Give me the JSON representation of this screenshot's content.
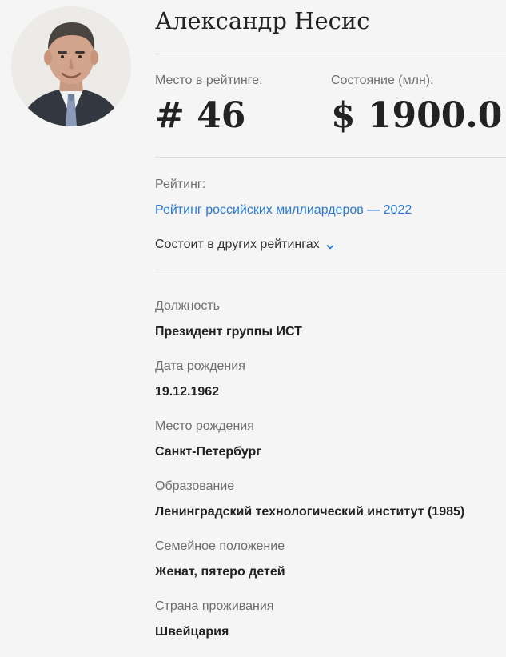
{
  "profile": {
    "name": "Александр Несис"
  },
  "stats": {
    "rank_label": "Место в рейтинге:",
    "rank_value": "# 46",
    "worth_label": "Состояние (млн):",
    "worth_value": "$ 1900.0"
  },
  "rating": {
    "label": "Рейтинг:",
    "link_text": "Рейтинг российских миллиардеров — 2022",
    "other_label": "Состоит в других рейтингах"
  },
  "facts": [
    {
      "label": "Должность",
      "value": "Президент группы ИСТ"
    },
    {
      "label": "Дата рождения",
      "value": "19.12.1962"
    },
    {
      "label": "Место рождения",
      "value": "Санкт-Петербург"
    },
    {
      "label": "Образование",
      "value": "Ленинградский технологический институт (1985)"
    },
    {
      "label": "Семейное положение",
      "value": "Женат, пятеро детей"
    },
    {
      "label": "Страна проживания",
      "value": "Швейцария"
    }
  ],
  "colors": {
    "background": "#f5f5f5",
    "link": "#2a7bd1",
    "muted_text": "#6f6f6f",
    "divider": "#dcdcdc"
  },
  "icons": {
    "expand": "chevron-down-icon"
  }
}
